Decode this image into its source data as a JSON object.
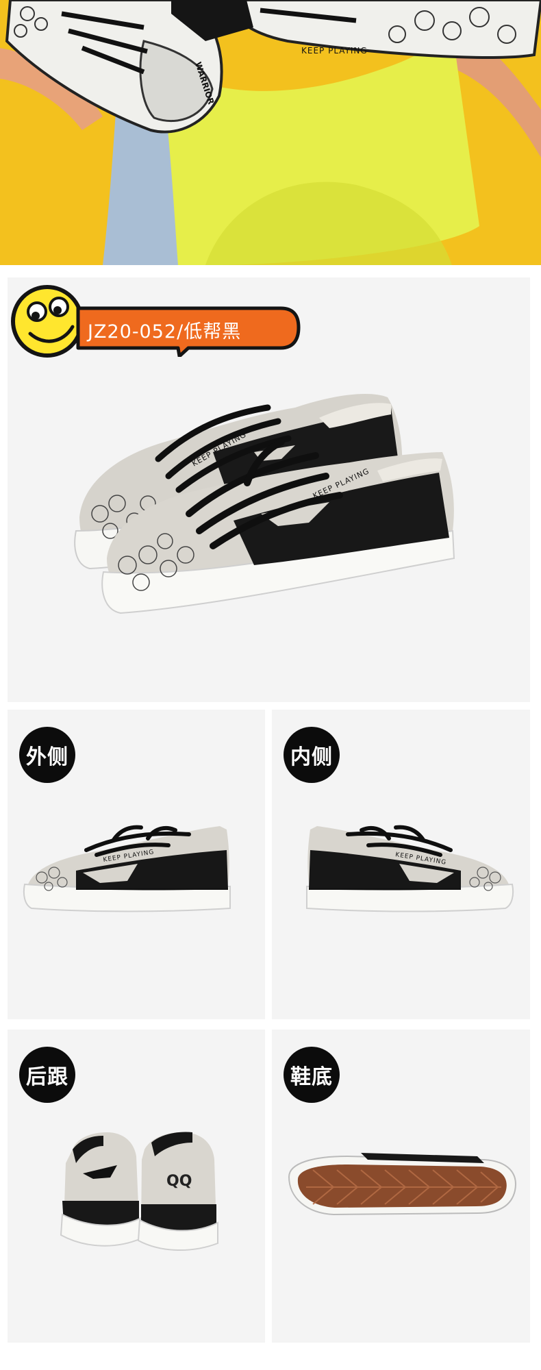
{
  "model_badge": {
    "text": "JZ20-052/低帮黑"
  },
  "views": [
    {
      "label": "外侧"
    },
    {
      "label": "内侧"
    },
    {
      "label": "后跟"
    },
    {
      "label": "鞋底"
    }
  ],
  "shoe_print": {
    "tagline": "KEEP PLAYING",
    "heel_mark": "QQ",
    "insole_brand": "WARRIOR"
  },
  "colors": {
    "hero_bg": "#f4c21c",
    "badge_orange": "#ef6a1e",
    "smiley_yellow": "#ffe62e",
    "panel_bg": "#f4f4f4",
    "label_bg": "#0c0c0c"
  }
}
